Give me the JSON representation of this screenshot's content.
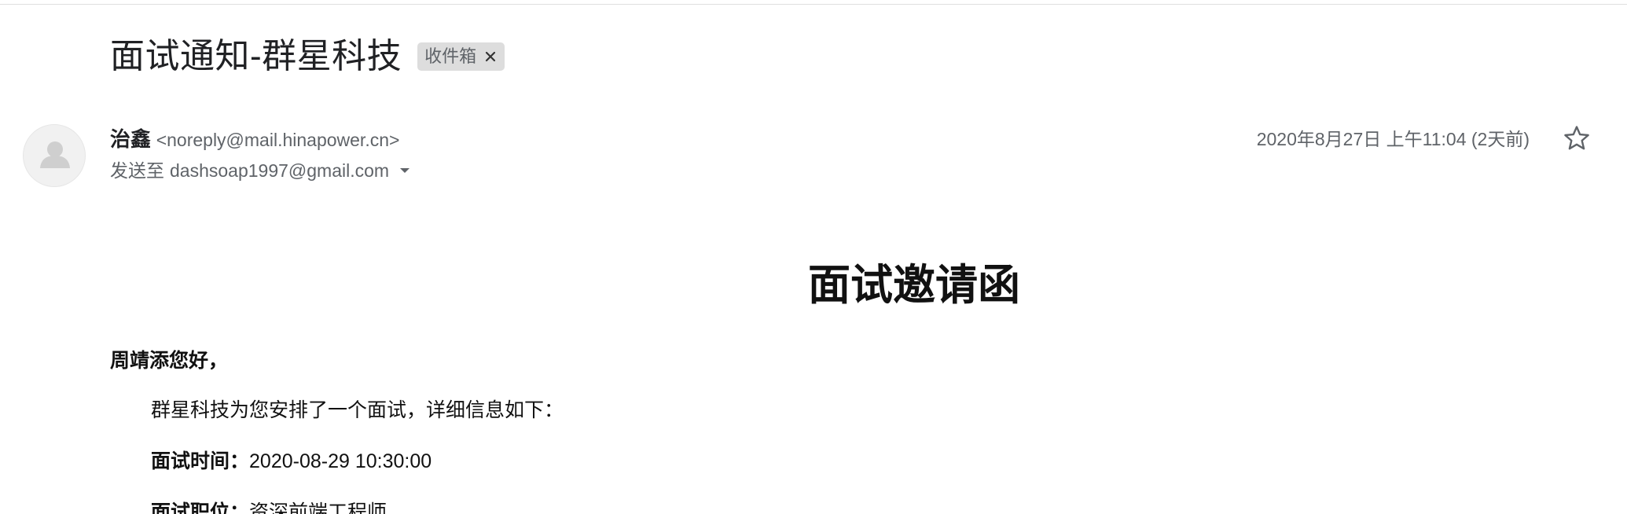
{
  "email": {
    "subject": "面试通知-群星科技",
    "label": {
      "text": "收件箱",
      "close_glyph": "×"
    },
    "sender": {
      "name": "治鑫",
      "email": "<noreply@mail.hinapower.cn>"
    },
    "recipient": {
      "prefix": "发送至",
      "email": "dashsoap1997@gmail.com"
    },
    "date": "2020年8月27日 上午11:04 (2天前)",
    "icons": {
      "avatar": "person-avatar-icon",
      "dropdown": "chevron-down-icon",
      "star": "star-icon"
    }
  },
  "message": {
    "title": "面试邀请函",
    "greeting": "周靖添您好，",
    "intro": "群星科技为您安排了一个面试，详细信息如下：",
    "time_label": "面试时间：",
    "time_value": "2020-08-29 10:30:00",
    "position_label": "面试职位：",
    "position_value": "资深前端工程师"
  },
  "colors": {
    "text_primary": "#202124",
    "text_secondary": "#5f6368",
    "chip_background": "#dddddd",
    "avatar_background": "#f1f1f1",
    "divider": "#e0e0e0"
  }
}
